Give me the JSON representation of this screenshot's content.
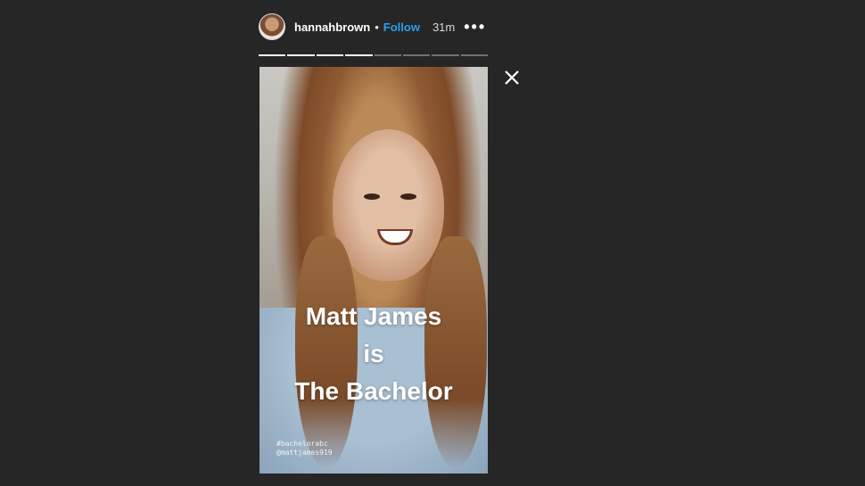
{
  "header": {
    "username": "hannahbrown",
    "separator": "•",
    "follow_label": "Follow",
    "time_ago": "31m",
    "more_label": "•••"
  },
  "progress": {
    "total_segments": 8,
    "completed_segments": 4
  },
  "story": {
    "caption_lines": [
      "Matt James",
      "is",
      "The Bachelor"
    ],
    "tags": [
      "#bachelorabc",
      "@mattjames919"
    ]
  },
  "icons": {
    "close": "close-icon",
    "more": "more-options-icon"
  },
  "colors": {
    "background": "#262626",
    "follow": "#2c9cf0",
    "text": "#ffffff"
  }
}
